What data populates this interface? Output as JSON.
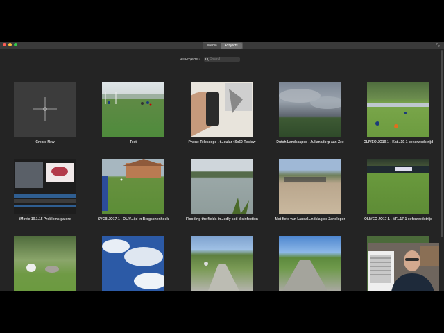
{
  "toolbar": {
    "tabs": [
      {
        "label": "Media",
        "active": false
      },
      {
        "label": "Projects",
        "active": true
      }
    ]
  },
  "filter": {
    "label": "All Projects ⁝",
    "search_placeholder": "Search",
    "search_icon": "magnifier-icon"
  },
  "projects": [
    {
      "title": "Create New"
    },
    {
      "title": "Test"
    },
    {
      "title": "Phone Telescope - t...cular 40x60 Review"
    },
    {
      "title": "Dutch Landscapes - Julianadorp aan Zee"
    },
    {
      "title": "OLIVEO JO19-1 - Kat...19-1 bekerwedstrijd"
    },
    {
      "title": "iMovie 10.1.15 Problems galore"
    },
    {
      "title": "SVCB JO17-1 - OLIV...ijd in Bergschenhoek"
    },
    {
      "title": "Flooding the fields in...edly soil disinfection"
    },
    {
      "title": "Met fiets van Landal...ndslag de Zandloper"
    },
    {
      "title": "OLIVEO JO17-1 - VF...17-1 oefenwedstrijd"
    },
    {
      "title": ""
    },
    {
      "title": ""
    },
    {
      "title": ""
    },
    {
      "title": ""
    },
    {
      "title": ""
    }
  ],
  "colors": {
    "window_bg": "#242424",
    "close": "#fc5c55",
    "minimize": "#fdbc40",
    "zoom": "#34c84a"
  }
}
